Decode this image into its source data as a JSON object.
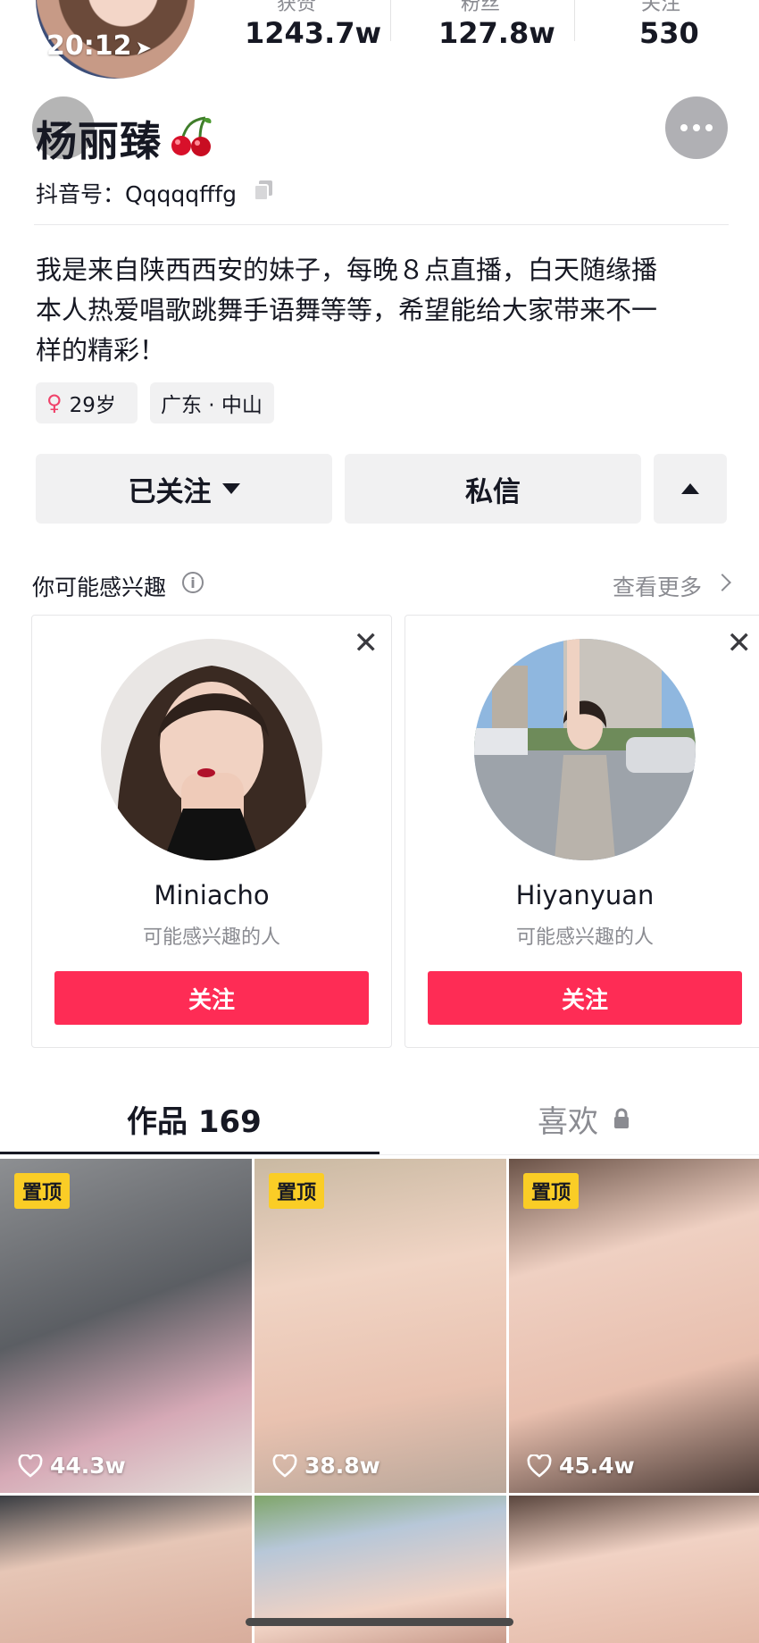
{
  "status_bar": {
    "time": "20:12"
  },
  "stats": [
    {
      "label": "获赞",
      "value": "1243.7w"
    },
    {
      "label": "粉丝",
      "value": "127.8w"
    },
    {
      "label": "关注",
      "value": "530"
    }
  ],
  "profile": {
    "name": "杨丽臻",
    "douyin_id": "抖音号：Qqqqqfffg",
    "bio": "我是来自陕西西安的妹子，每晚８点直播，白天随缘播\n本人热爱唱歌跳舞手语舞等等，希望能给大家带来不一\n样的精彩！",
    "age": "29岁",
    "location": "广东 · 中山"
  },
  "actions": {
    "following_label": "已关注",
    "message_label": "私信"
  },
  "suggestions": {
    "title": "你可能感兴趣",
    "see_more": "查看更多",
    "cards": [
      {
        "name": "Miniacho",
        "subtitle": "可能感兴趣的人",
        "follow_label": "关注"
      },
      {
        "name": "Hiyanyuan",
        "subtitle": "可能感兴趣的人",
        "follow_label": "关注"
      }
    ]
  },
  "tabs": {
    "works": "作品 169",
    "likes": "喜欢"
  },
  "videos": [
    {
      "pinned": "置顶",
      "likes": "44.3w"
    },
    {
      "pinned": "置顶",
      "likes": "38.8w"
    },
    {
      "pinned": "置顶",
      "likes": "45.4w"
    }
  ],
  "colors": {
    "accent": "#fe2c55",
    "pin_badge": "#facd26",
    "text_primary": "#161823",
    "text_secondary": "#8a8b91"
  }
}
